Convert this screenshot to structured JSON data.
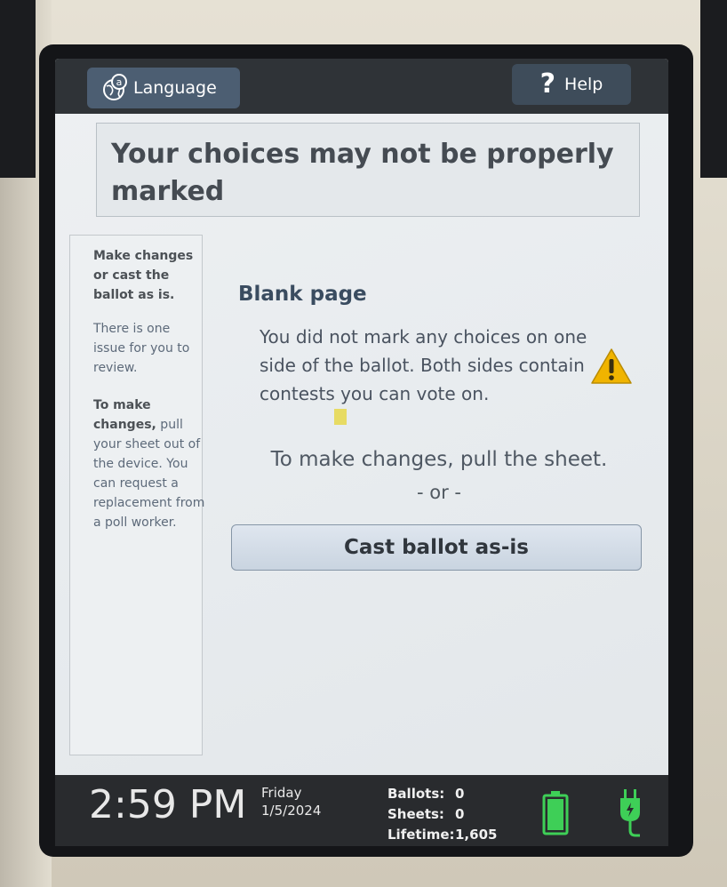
{
  "topbar": {
    "language_label": "Language",
    "help_label": "Help",
    "help_glyph": "?"
  },
  "header": {
    "title": "Your choices may not be properly marked"
  },
  "sidebar": {
    "intro": "Make changes or cast the ballot as is.",
    "issue_text": "There is one issue for you to review.",
    "instructions_bold": "To make changes,",
    "instructions_rest": " pull your sheet out of the device. You can request a replacement from a poll worker."
  },
  "main": {
    "issue_title": "Blank page",
    "issue_message": "You did not mark any choices on one side of the ballot. Both sides contain contests you can vote on.",
    "pull_instruction": "To make changes, pull the sheet.",
    "or_separator": "- or -",
    "cast_button_label": "Cast ballot as-is"
  },
  "status": {
    "time": "2:59 PM",
    "day": "Friday",
    "date": "1/5/2024",
    "ballots_label": "Ballots:",
    "ballots_value": "0",
    "sheets_label": "Sheets:",
    "sheets_value": "0",
    "lifetime_label": "Lifetime:",
    "lifetime_value": "1,605"
  },
  "icons": {
    "language": "globe-language-icon",
    "help": "question-mark-icon",
    "warning": "warning-triangle-icon",
    "battery": "battery-icon",
    "power": "power-plug-icon"
  },
  "colors": {
    "warning": "#f0b400",
    "battery": "#3ecf57",
    "plug": "#3ecf57",
    "button_blue": "#4c5e72",
    "title_blue": "#3a4c60"
  }
}
